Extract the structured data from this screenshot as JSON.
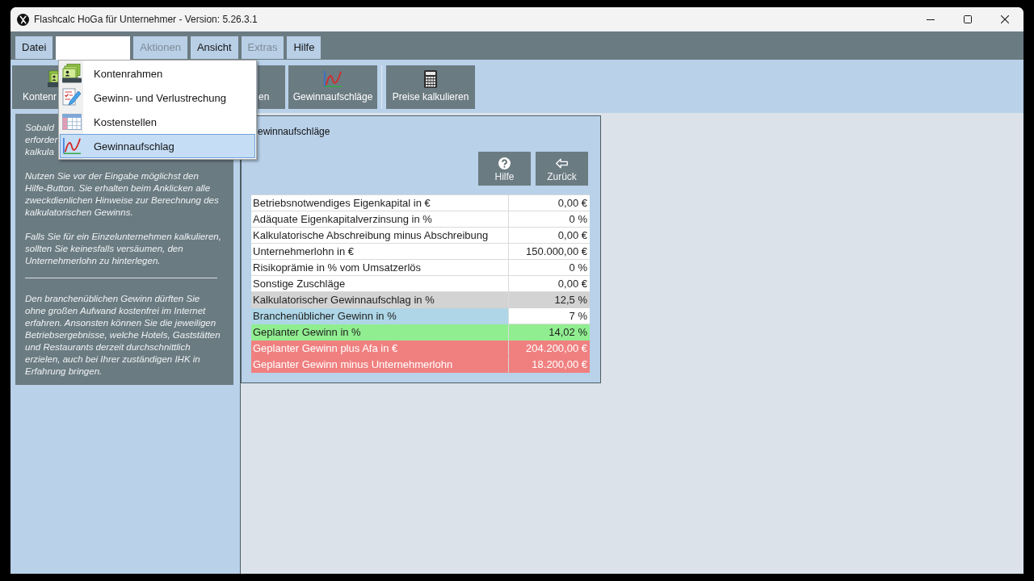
{
  "window": {
    "title": "Flashcalc HoGa für Unternehmer - Version: 5.26.3.1"
  },
  "menu_bar": [
    {
      "label": "Datei",
      "disabled": false,
      "open": false
    },
    {
      "disabled": false,
      "open": true
    },
    {
      "label": "Aktionen",
      "disabled": true,
      "open": false
    },
    {
      "label": "Ansicht",
      "disabled": false,
      "open": false
    },
    {
      "label": "Extras",
      "disabled": true,
      "open": false
    },
    {
      "label": "Hilfe",
      "disabled": false,
      "open": false
    }
  ],
  "dropdown_menu": {
    "items": [
      {
        "label": "Kontenrahmen",
        "selected": false
      },
      {
        "label": "Gewinn- und Verlustrechung",
        "selected": false
      },
      {
        "label": "Kostenstellen",
        "selected": false
      },
      {
        "label": "Gewinnaufschlag",
        "selected": true
      }
    ]
  },
  "toolbar": {
    "buttons": [
      {
        "label": "Kontenr"
      },
      {
        "label": "en"
      },
      {
        "label": "Gewinnaufschläge"
      },
      {
        "label": "Preise kalkulieren"
      }
    ]
  },
  "info_panel": {
    "cut_paragraph_lines": [
      "Sobald",
      "erforder",
      "kalkula"
    ],
    "paragraphs": [
      "Nutzen Sie vor der Eingabe möglichst den Hilfe-Button. Sie erhalten beim Anklicken alle zweckdienlichen Hinweise zur Berechnung des kalkulatorischen Gewinns.",
      "Falls Sie für ein Einzelunternehmen kalkulieren, sollten Sie keinesfalls versäumen, den Unternehmerlohn zu hinterlegen."
    ],
    "note": "Den branchenüblichen Gewinn dürften Sie ohne großen Aufwand kostenfrei im Internet erfahren. Ansonsten können Sie die jeweiligen Betriebsergebnisse, welche Hotels, Gaststätten und Restaurants derzeit durchschnittlich erzielen, auch bei Ihrer zuständigen IHK in Erfahrung bringen."
  },
  "profit_panel": {
    "title": "ewinnaufschläge",
    "buttons": [
      {
        "label": "Hilfe"
      },
      {
        "label": "Zurück"
      }
    ],
    "rows": [
      {
        "label": "Betriebsnotwendiges Eigenkapital in €",
        "value": "0,00 €",
        "kind": "input"
      },
      {
        "label": "Adäquate Eigenkapitalverzinsung in %",
        "value": "0 %",
        "kind": "input"
      },
      {
        "label": "Kalkulatorische Abschreibung minus Abschreibung",
        "value": "0,00 €",
        "kind": "input"
      },
      {
        "label": "Unternehmerlohn in €",
        "value": "150.000,00 €",
        "kind": "input"
      },
      {
        "label": "Risikoprämie in % vom Umsatzerlös",
        "value": "0 %",
        "kind": "input"
      },
      {
        "label": "Sonstige Zuschläge",
        "value": "0,00 €",
        "kind": "input"
      },
      {
        "label": "Kalkulatorischer Gewinnaufschlag in %",
        "value": "12,5 %",
        "kind": "computed"
      },
      {
        "label": "Branchenüblicher Gewinn in %",
        "value": "7 %",
        "kind": "reference"
      },
      {
        "label": "Geplanter Gewinn in %",
        "value": "14,02 %",
        "kind": "result"
      },
      {
        "label": "Geplanter Gewinn plus Afa in €",
        "value": "204.200,00 €",
        "kind": "alert"
      },
      {
        "label": "Geplanter Gewinn minus Unternehmerlohn",
        "value": "18.200,00 €",
        "kind": "alert"
      }
    ]
  }
}
